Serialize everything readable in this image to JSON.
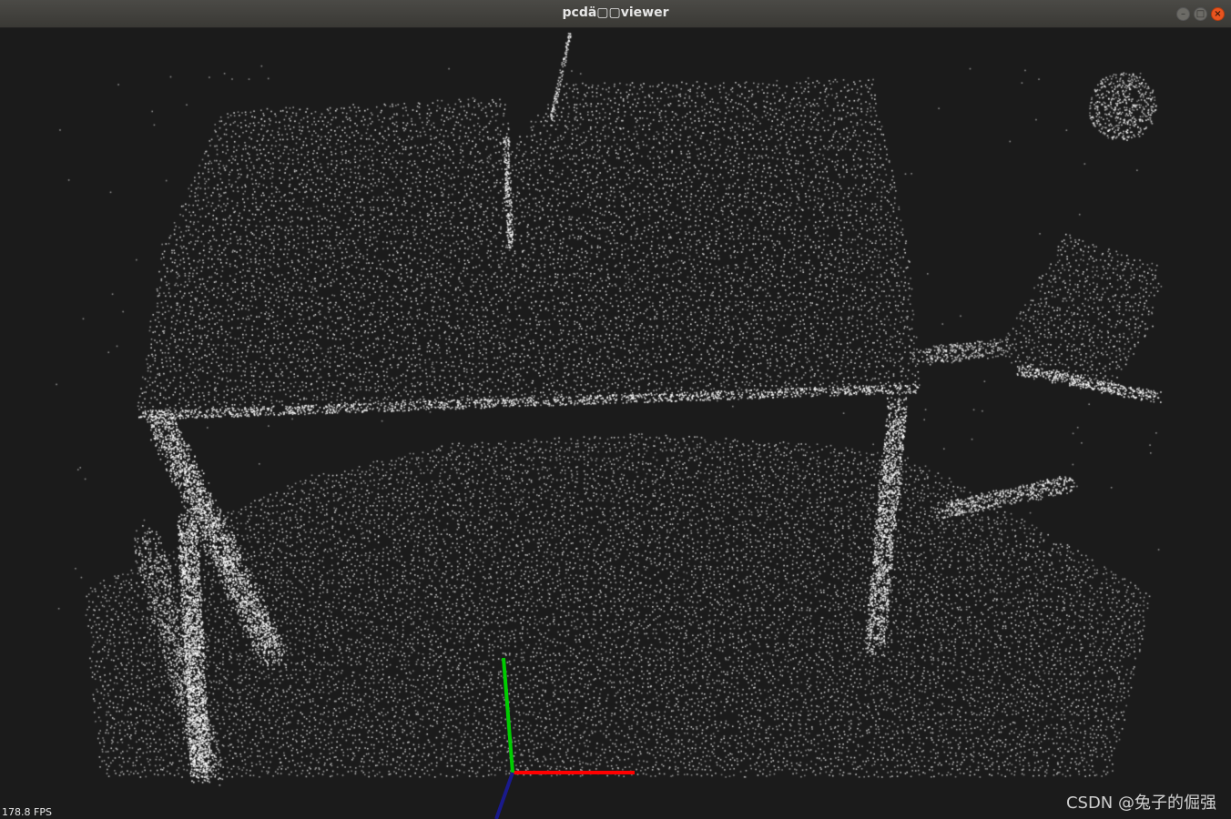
{
  "window": {
    "title": "pcdä▢▢viewer",
    "minimize_glyph": "–",
    "maximize_glyph": "□",
    "close_glyph": "×",
    "close_color": "#e9541f"
  },
  "viewer": {
    "background_color": "#1b1b1b",
    "point_color": "#ffffff",
    "fps_label": "178.8 FPS",
    "axes": {
      "x_color": "#ff0000",
      "y_color": "#00cc00",
      "z_color": "#1a1a8c"
    }
  },
  "watermark": "CSDN @兔子的倔强"
}
